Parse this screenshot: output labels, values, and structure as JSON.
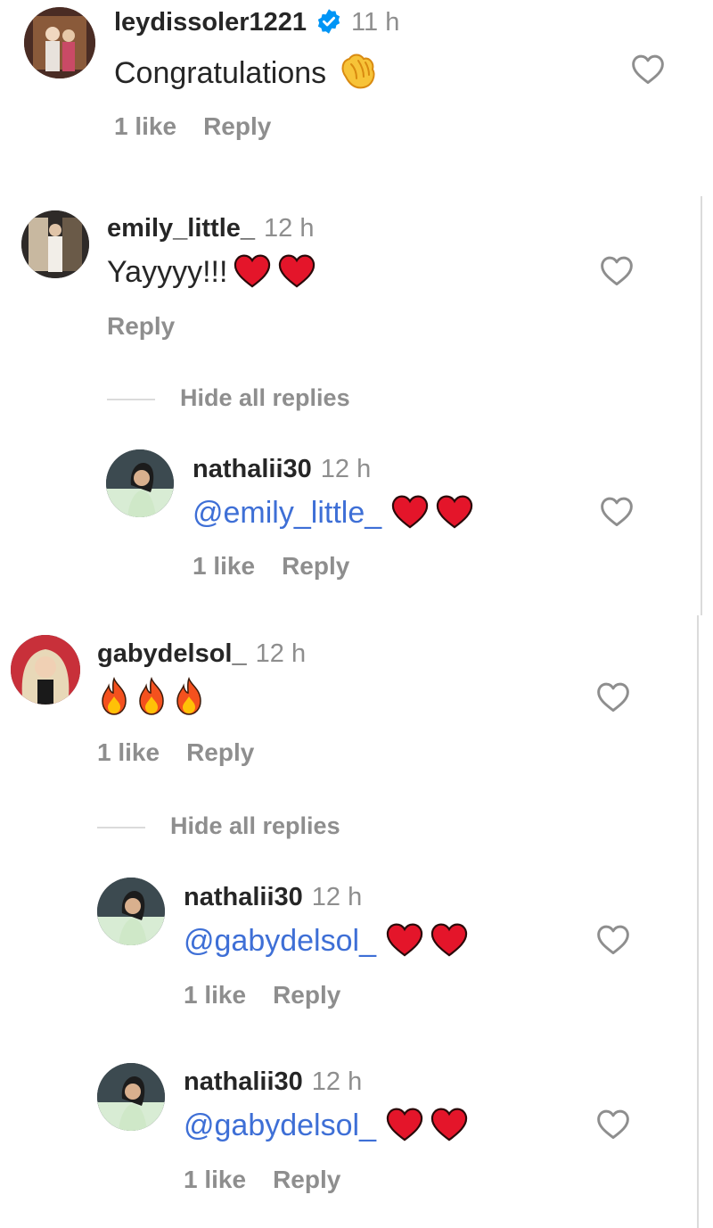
{
  "comments": [
    {
      "username": "leydissoler1221",
      "verified": true,
      "time": "11 h",
      "text": "Congratulations",
      "likes": "1 like",
      "reply": "Reply"
    },
    {
      "username": "emily_little_",
      "time": "12 h",
      "text": "Yayyyy!!!",
      "reply": "Reply",
      "toggle": "Hide all replies",
      "replies": [
        {
          "username": "nathalii30",
          "time": "12 h",
          "mention": "@emily_little_",
          "likes": "1 like",
          "reply": "Reply"
        }
      ]
    },
    {
      "username": "gabydelsol_",
      "time": "12 h",
      "text": "",
      "likes": "1 like",
      "reply": "Reply",
      "toggle": "Hide all replies",
      "replies": [
        {
          "username": "nathalii30",
          "time": "12 h",
          "mention": "@gabydelsol_",
          "likes": "1 like",
          "reply": "Reply"
        },
        {
          "username": "nathalii30",
          "time": "12 h",
          "mention": "@gabydelsol_",
          "likes": "1 like",
          "reply": "Reply"
        }
      ]
    }
  ],
  "icons": {
    "like": "heart-outline-icon",
    "verified": "verified-badge-icon",
    "emoji_heart": "red-heart-emoji",
    "emoji_fire": "fire-emoji",
    "emoji_clap": "clapping-hands-emoji"
  },
  "colors": {
    "mention": "#3e6fd6",
    "verified": "#0095f6",
    "secondary_text": "#8e8e8e",
    "heart_emoji": "#e4152a"
  }
}
